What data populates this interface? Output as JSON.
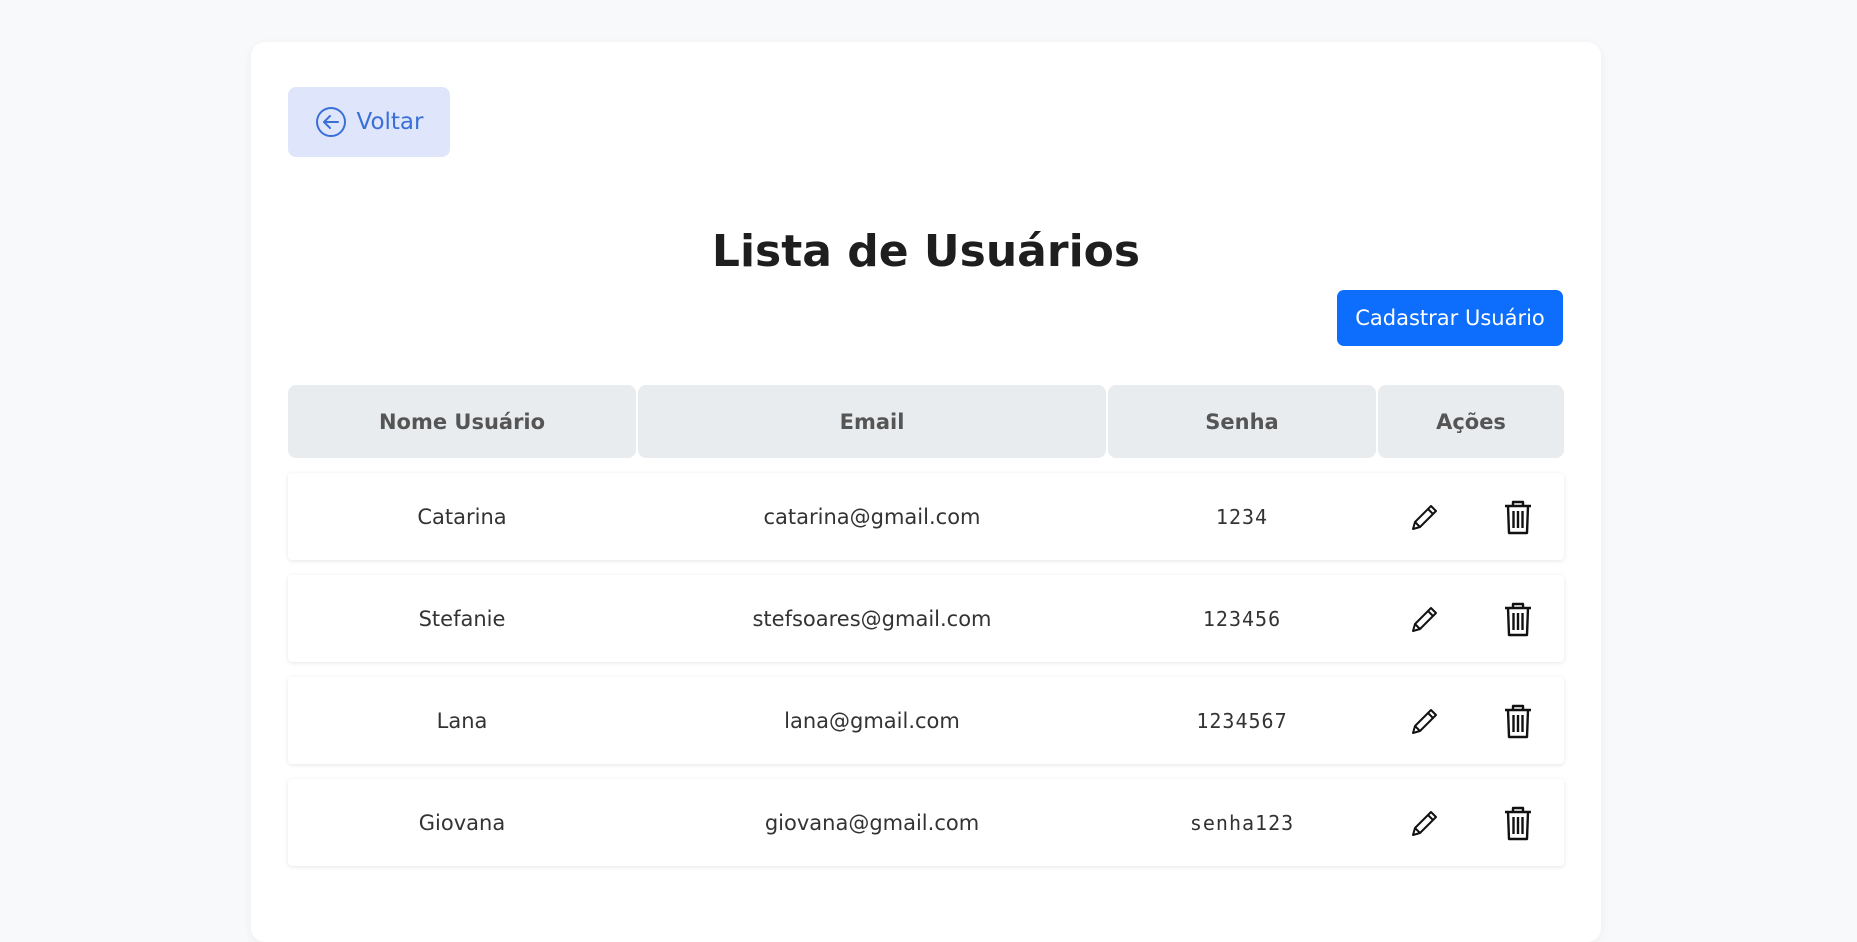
{
  "back_button": {
    "label": "Voltar",
    "icon": "arrow-left-circle-icon"
  },
  "page_title": "Lista de Usuários",
  "add_button": {
    "label": "Cadastrar Usuário"
  },
  "table": {
    "headers": [
      "Nome Usuário",
      "Email",
      "Senha",
      "Ações"
    ],
    "rows": [
      {
        "name": "Catarina",
        "email": "catarina@gmail.com",
        "password": "1234"
      },
      {
        "name": "Stefanie",
        "email": "stefsoares@gmail.com",
        "password": "123456"
      },
      {
        "name": "Lana",
        "email": "lana@gmail.com",
        "password": "1234567"
      },
      {
        "name": "Giovana",
        "email": "giovana@gmail.com",
        "password": "senha123"
      }
    ],
    "row_actions": [
      "edit-pencil-icon",
      "delete-trash-icon"
    ]
  },
  "colors": {
    "primary": "#0d6efd",
    "back_button_bg": "#dfe6fb",
    "back_button_text": "#3b6fd8",
    "header_bg": "#e9ecef",
    "page_bg": "#f8f9fb"
  }
}
